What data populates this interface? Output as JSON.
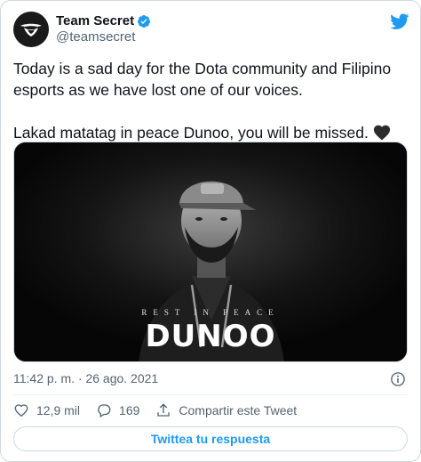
{
  "author": {
    "display_name": "Team Secret",
    "handle": "@teamsecret",
    "verified": true,
    "avatar_icon": "team-secret-logo-icon"
  },
  "tweet": {
    "paragraph_1": "Today is a sad day for the Dota community and Filipino esports as we have lost one of our voices.",
    "paragraph_2": "Lakad matatag in peace Dunoo, you will be missed.",
    "emoji": "black-heart-icon"
  },
  "media": {
    "caption_top": "REST IN PEACE",
    "caption_name": "DUNOO"
  },
  "meta": {
    "timestamp": "11:42 p. m. · 26 ago. 2021"
  },
  "actions": {
    "likes": "12,9 mil",
    "replies": "169",
    "share_label": "Compartir este Tweet"
  },
  "reply_button": {
    "label": "Twittea tu respuesta"
  },
  "colors": {
    "accent": "#1d9bf0",
    "text_primary": "#0f1419",
    "text_secondary": "#536471",
    "border": "#cfd9de"
  }
}
